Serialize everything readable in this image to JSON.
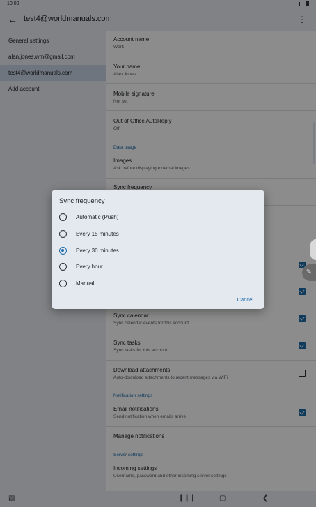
{
  "status_bar": {
    "time": "10.00"
  },
  "app_bar": {
    "title": "test4@worldmanuals.com",
    "back_icon": "arrow-left-icon",
    "more_icon": "more-vert-icon"
  },
  "left_pane": {
    "items": [
      {
        "label": "General settings",
        "selected": false
      },
      {
        "label": "alan.jones.wm@gmail.com",
        "selected": false
      },
      {
        "label": "test4@worldmanuals.com",
        "selected": true
      },
      {
        "label": "Add account",
        "selected": false
      }
    ]
  },
  "settings": {
    "account_name": {
      "title": "Account name",
      "value": "Work"
    },
    "your_name": {
      "title": "Your name",
      "value": "Alan Jones"
    },
    "mobile_signature": {
      "title": "Mobile signature",
      "value": "Not set"
    },
    "out_of_office": {
      "title": "Out of Office AutoReply",
      "value": "Off"
    },
    "data_usage_header": "Data usage",
    "images": {
      "title": "Images",
      "value": "Ask before displaying external images"
    },
    "sync_frequency": {
      "title": "Sync frequency"
    },
    "sync_calendar": {
      "title": "Sync calendar",
      "value": "Sync calendar events for this account",
      "checked": true
    },
    "sync_tasks": {
      "title": "Sync tasks",
      "value": "Sync tasks for this account",
      "checked": true
    },
    "download_attachments": {
      "title": "Download attachments",
      "value": "Auto-download attachments to recent messages via WiFi",
      "checked": false
    },
    "notification_header": "Notification settings",
    "email_notifications": {
      "title": "Email notifications",
      "value": "Send notification when emails arrive",
      "checked": true
    },
    "manage_notifications": {
      "title": "Manage notifications"
    },
    "server_header": "Server settings",
    "incoming_settings": {
      "title": "Incoming settings",
      "value": "Username, password and other incoming server settings"
    }
  },
  "dialog": {
    "title": "Sync frequency",
    "options": [
      {
        "label": "Automatic (Push)",
        "selected": false
      },
      {
        "label": "Every 15 minutes",
        "selected": false
      },
      {
        "label": "Every 30 minutes",
        "selected": true
      },
      {
        "label": "Every hour",
        "selected": false
      },
      {
        "label": "Manual",
        "selected": false
      }
    ],
    "cancel_label": "Cancel"
  },
  "colors": {
    "accent": "#1a6aa8",
    "scrim": "rgba(0,0,0,0.45)"
  }
}
